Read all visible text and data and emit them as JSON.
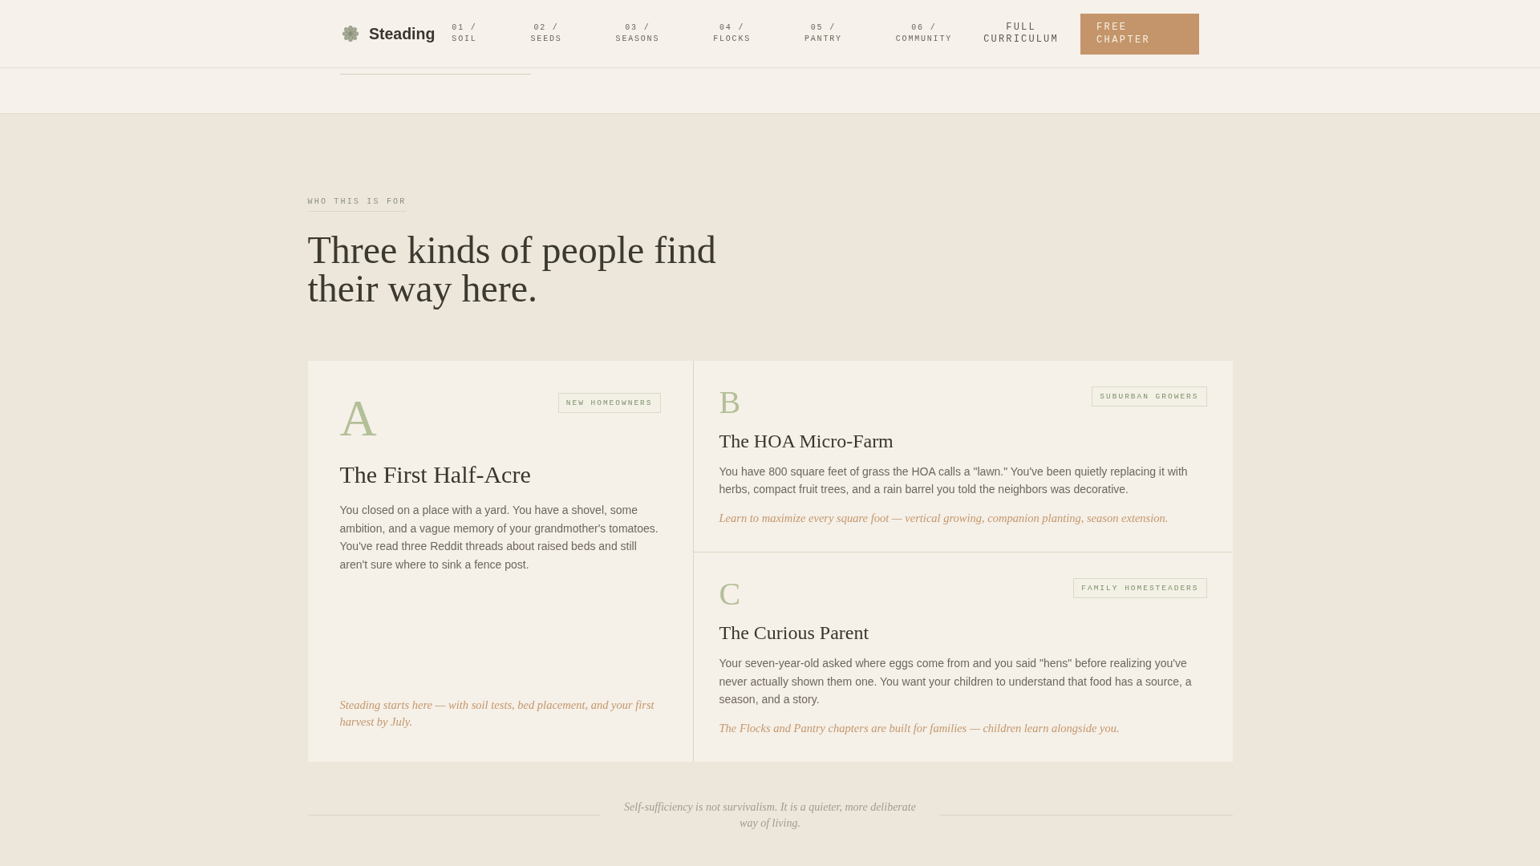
{
  "nav": {
    "brand": "Steading",
    "links": [
      {
        "number": "01 /",
        "label": "SOIL"
      },
      {
        "number": "02 /",
        "label": "SEEDS"
      },
      {
        "number": "03 /",
        "label": "SEASONS"
      },
      {
        "number": "04 /",
        "label": "FLOCKS"
      },
      {
        "number": "05 /",
        "label": "PANTRY"
      },
      {
        "number": "06 /",
        "label": "COMMUNITY"
      }
    ],
    "curriculum_link": "FULL CURRICULUM",
    "cta": "FREE CHAPTER"
  },
  "section": {
    "eyebrow": "WHO THIS IS FOR",
    "heading": "Three kinds of people find their way here.",
    "cards": [
      {
        "kind": "feature",
        "letter": "A",
        "tag": "NEW HOMEOWNERS",
        "title": "The First Half-Acre",
        "body": "You closed on a place with a yard. You have a shovel, some ambition, and a vague memory of your grandmother's tomatoes. You've read three Reddit threads about raised beds and still aren't sure where to sink a fence post.",
        "note": "Steading starts here — with soil tests, bed placement, and your first harvest by July."
      },
      {
        "kind": "compact",
        "letter": "B",
        "tag": "SUBURBAN GROWERS",
        "title": "The HOA Micro-Farm",
        "body": "You have 800 square feet of grass the HOA calls a \"lawn.\" You've been quietly replacing it with herbs, compact fruit trees, and a rain barrel you told the neighbors was decorative.",
        "note": "Learn to maximize every square foot — vertical growing, companion planting, season extension."
      },
      {
        "kind": "compact",
        "letter": "C",
        "tag": "FAMILY HOMESTEADERS",
        "title": "The Curious Parent",
        "body": "Your seven-year-old asked where eggs come from and you said \"hens\" before realizing you've never actually shown them one. You want your children to understand that food has a source, a season, and a story.",
        "note": "The Flocks and Pantry chapters are built for families — children learn alongside you."
      }
    ],
    "quote": "Self-sufficiency is not survivalism. It is a quieter, more deliberate way of living."
  }
}
